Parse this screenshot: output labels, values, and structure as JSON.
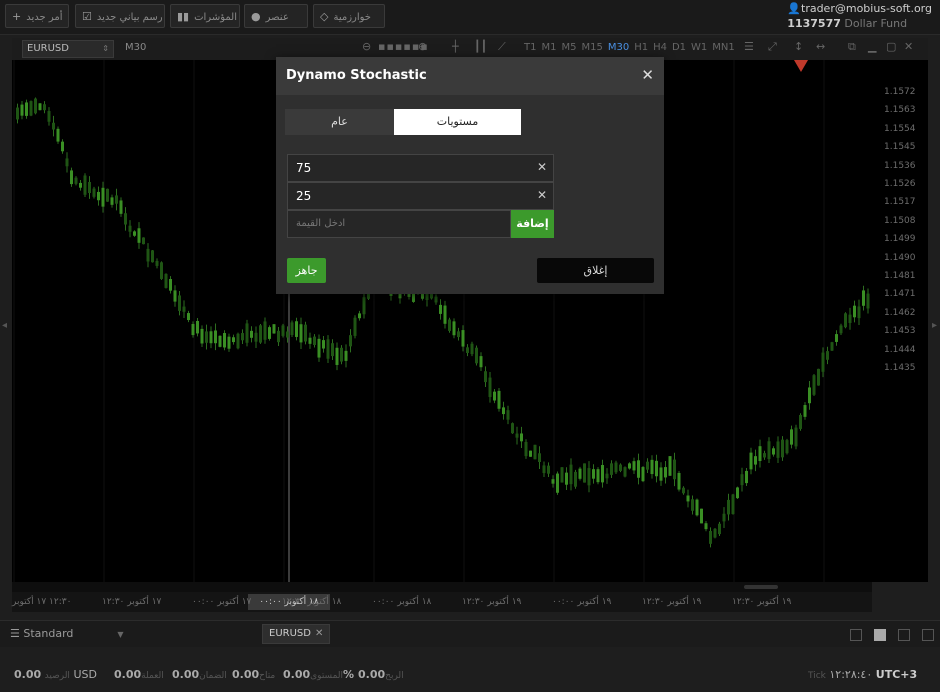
{
  "toolbar": {
    "new_order": "أمر جديد",
    "new_chart": "رسم بياني جديد",
    "indicators": "المؤشرات",
    "element": "عنصر",
    "algorithm": "خوارزمية"
  },
  "account": {
    "email": "trader@mobius-soft.org",
    "number": "1137577",
    "fund": "Dollar Fund"
  },
  "chart": {
    "symbol": "EURUSD",
    "timeframe": "M30",
    "timeframes": [
      "T1",
      "M1",
      "M5",
      "M15",
      "M30",
      "H1",
      "H4",
      "D1",
      "W1",
      "MN1"
    ],
    "active_timeframe": "M30",
    "y_labels": [
      "1.1572",
      "1.1563",
      "1.1554",
      "1.1545",
      "1.1536",
      "1.1526",
      "1.1517",
      "1.1508",
      "1.1499",
      "1.1490",
      "1.1481",
      "1.1471",
      "1.1462",
      "1.1453",
      "1.1444",
      "1.1435"
    ],
    "x_labels": [
      "١٢:٣٠ ١٧ أكتوبر",
      "١٧ أكتوبر ١٢:٣٠",
      "١٧ أكتوبر ٠٠:٠٠",
      "١٨ أكتوبر ١٢:٣٠",
      "١٨ أكتوبر ٠٠:٠٠",
      "١٩ أكتوبر ١٢:٣٠",
      "١٩ أكتوبر ٠٠:٠٠",
      "١٩ أكتوبر ١٢:٣٠",
      "١٩ أكتوبر ١٢:٣٠"
    ],
    "x_cursor": "١٨ أكتوبر ٠٠:٠٠"
  },
  "bottom": {
    "layout_name": "Standard",
    "tab": "EURUSD"
  },
  "status": {
    "balance_value": "0.00",
    "balance_currency": "USD",
    "balance_label": "الرصيد",
    "equity_value": "0.00",
    "equity_label": "العملة",
    "margin_value": "0.00",
    "margin_label": "الضمان",
    "free_value": "0.00",
    "free_label": "متاح",
    "level_value": "0.00",
    "level_label": "المستوى",
    "level_unit": "%",
    "profit_value": "0.00",
    "profit_label": "الربح",
    "tick_label": "Tick",
    "time": "١٢:٢٨:٤٠",
    "tz": "UTC+3"
  },
  "dialog": {
    "title": "Dynamo Stochastic",
    "tab_general": "عام",
    "tab_levels": "مستويات",
    "levels": [
      "75",
      "25"
    ],
    "add_placeholder": "ادخل القيمة",
    "add_button": "إضافة",
    "ready_button": "جاهز",
    "close_button": "إغلاق"
  }
}
